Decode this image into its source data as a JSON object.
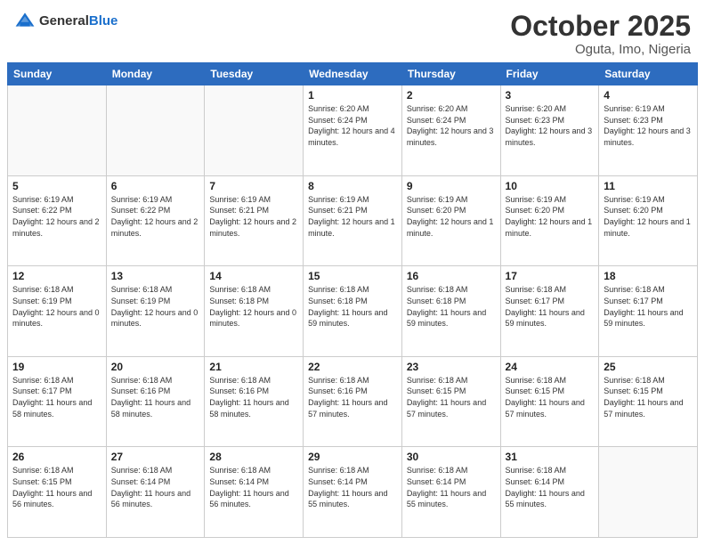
{
  "header": {
    "logo_general": "General",
    "logo_blue": "Blue",
    "month": "October 2025",
    "location": "Oguta, Imo, Nigeria"
  },
  "weekdays": [
    "Sunday",
    "Monday",
    "Tuesday",
    "Wednesday",
    "Thursday",
    "Friday",
    "Saturday"
  ],
  "weeks": [
    [
      {
        "day": "",
        "info": ""
      },
      {
        "day": "",
        "info": ""
      },
      {
        "day": "",
        "info": ""
      },
      {
        "day": "1",
        "info": "Sunrise: 6:20 AM\nSunset: 6:24 PM\nDaylight: 12 hours\nand 4 minutes."
      },
      {
        "day": "2",
        "info": "Sunrise: 6:20 AM\nSunset: 6:24 PM\nDaylight: 12 hours\nand 3 minutes."
      },
      {
        "day": "3",
        "info": "Sunrise: 6:20 AM\nSunset: 6:23 PM\nDaylight: 12 hours\nand 3 minutes."
      },
      {
        "day": "4",
        "info": "Sunrise: 6:19 AM\nSunset: 6:23 PM\nDaylight: 12 hours\nand 3 minutes."
      }
    ],
    [
      {
        "day": "5",
        "info": "Sunrise: 6:19 AM\nSunset: 6:22 PM\nDaylight: 12 hours\nand 2 minutes."
      },
      {
        "day": "6",
        "info": "Sunrise: 6:19 AM\nSunset: 6:22 PM\nDaylight: 12 hours\nand 2 minutes."
      },
      {
        "day": "7",
        "info": "Sunrise: 6:19 AM\nSunset: 6:21 PM\nDaylight: 12 hours\nand 2 minutes."
      },
      {
        "day": "8",
        "info": "Sunrise: 6:19 AM\nSunset: 6:21 PM\nDaylight: 12 hours\nand 1 minute."
      },
      {
        "day": "9",
        "info": "Sunrise: 6:19 AM\nSunset: 6:20 PM\nDaylight: 12 hours\nand 1 minute."
      },
      {
        "day": "10",
        "info": "Sunrise: 6:19 AM\nSunset: 6:20 PM\nDaylight: 12 hours\nand 1 minute."
      },
      {
        "day": "11",
        "info": "Sunrise: 6:19 AM\nSunset: 6:20 PM\nDaylight: 12 hours\nand 1 minute."
      }
    ],
    [
      {
        "day": "12",
        "info": "Sunrise: 6:18 AM\nSunset: 6:19 PM\nDaylight: 12 hours\nand 0 minutes."
      },
      {
        "day": "13",
        "info": "Sunrise: 6:18 AM\nSunset: 6:19 PM\nDaylight: 12 hours\nand 0 minutes."
      },
      {
        "day": "14",
        "info": "Sunrise: 6:18 AM\nSunset: 6:18 PM\nDaylight: 12 hours\nand 0 minutes."
      },
      {
        "day": "15",
        "info": "Sunrise: 6:18 AM\nSunset: 6:18 PM\nDaylight: 11 hours\nand 59 minutes."
      },
      {
        "day": "16",
        "info": "Sunrise: 6:18 AM\nSunset: 6:18 PM\nDaylight: 11 hours\nand 59 minutes."
      },
      {
        "day": "17",
        "info": "Sunrise: 6:18 AM\nSunset: 6:17 PM\nDaylight: 11 hours\nand 59 minutes."
      },
      {
        "day": "18",
        "info": "Sunrise: 6:18 AM\nSunset: 6:17 PM\nDaylight: 11 hours\nand 59 minutes."
      }
    ],
    [
      {
        "day": "19",
        "info": "Sunrise: 6:18 AM\nSunset: 6:17 PM\nDaylight: 11 hours\nand 58 minutes."
      },
      {
        "day": "20",
        "info": "Sunrise: 6:18 AM\nSunset: 6:16 PM\nDaylight: 11 hours\nand 58 minutes."
      },
      {
        "day": "21",
        "info": "Sunrise: 6:18 AM\nSunset: 6:16 PM\nDaylight: 11 hours\nand 58 minutes."
      },
      {
        "day": "22",
        "info": "Sunrise: 6:18 AM\nSunset: 6:16 PM\nDaylight: 11 hours\nand 57 minutes."
      },
      {
        "day": "23",
        "info": "Sunrise: 6:18 AM\nSunset: 6:15 PM\nDaylight: 11 hours\nand 57 minutes."
      },
      {
        "day": "24",
        "info": "Sunrise: 6:18 AM\nSunset: 6:15 PM\nDaylight: 11 hours\nand 57 minutes."
      },
      {
        "day": "25",
        "info": "Sunrise: 6:18 AM\nSunset: 6:15 PM\nDaylight: 11 hours\nand 57 minutes."
      }
    ],
    [
      {
        "day": "26",
        "info": "Sunrise: 6:18 AM\nSunset: 6:15 PM\nDaylight: 11 hours\nand 56 minutes."
      },
      {
        "day": "27",
        "info": "Sunrise: 6:18 AM\nSunset: 6:14 PM\nDaylight: 11 hours\nand 56 minutes."
      },
      {
        "day": "28",
        "info": "Sunrise: 6:18 AM\nSunset: 6:14 PM\nDaylight: 11 hours\nand 56 minutes."
      },
      {
        "day": "29",
        "info": "Sunrise: 6:18 AM\nSunset: 6:14 PM\nDaylight: 11 hours\nand 55 minutes."
      },
      {
        "day": "30",
        "info": "Sunrise: 6:18 AM\nSunset: 6:14 PM\nDaylight: 11 hours\nand 55 minutes."
      },
      {
        "day": "31",
        "info": "Sunrise: 6:18 AM\nSunset: 6:14 PM\nDaylight: 11 hours\nand 55 minutes."
      },
      {
        "day": "",
        "info": ""
      }
    ]
  ]
}
